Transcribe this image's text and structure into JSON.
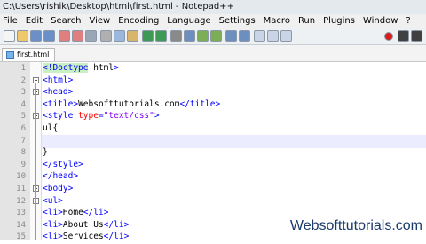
{
  "window": {
    "title": "C:\\Users\\rishik\\Desktop\\html\\first.html - Notepad++"
  },
  "menu": [
    "File",
    "Edit",
    "Search",
    "View",
    "Encoding",
    "Language",
    "Settings",
    "Macro",
    "Run",
    "Plugins",
    "Window",
    "?"
  ],
  "tabs": [
    {
      "label": "first.html"
    }
  ],
  "toolbar_icons": [
    "new-file-icon",
    "open-file-icon",
    "save-icon",
    "save-all-icon",
    "close-icon",
    "close-all-icon",
    "print-icon",
    "cut-icon",
    "copy-icon",
    "paste-icon",
    "undo-icon",
    "redo-icon",
    "find-icon",
    "replace-icon",
    "zoom-in-icon",
    "zoom-out-icon",
    "sync-v-icon",
    "sync-h-icon",
    "wrap-icon",
    "all-chars-icon",
    "indent-guide-icon",
    "record-macro-icon",
    "stop-macro-icon",
    "play-macro-icon"
  ],
  "editor": {
    "current_line": 7,
    "lines": [
      {
        "n": "1",
        "text": "<!Doctype html>"
      },
      {
        "n": "2",
        "text": "<html>"
      },
      {
        "n": "3",
        "text": "<head>"
      },
      {
        "n": "4",
        "text": "<title>Websofttutorials.com</title>"
      },
      {
        "n": "5",
        "text": "<style type=\"text/css\">"
      },
      {
        "n": "6",
        "text": "ul{"
      },
      {
        "n": "7",
        "text": ""
      },
      {
        "n": "8",
        "text": "}"
      },
      {
        "n": "9",
        "text": "</style>"
      },
      {
        "n": "10",
        "text": "</head>"
      },
      {
        "n": "11",
        "text": "<body>"
      },
      {
        "n": "12",
        "text": "<ul>"
      },
      {
        "n": "13",
        "text": "<li>Home</li>"
      },
      {
        "n": "14",
        "text": "<li>About Us</li>"
      },
      {
        "n": "15",
        "text": "<li>Services</li>"
      }
    ]
  },
  "watermark": "Websofttutorials.com"
}
